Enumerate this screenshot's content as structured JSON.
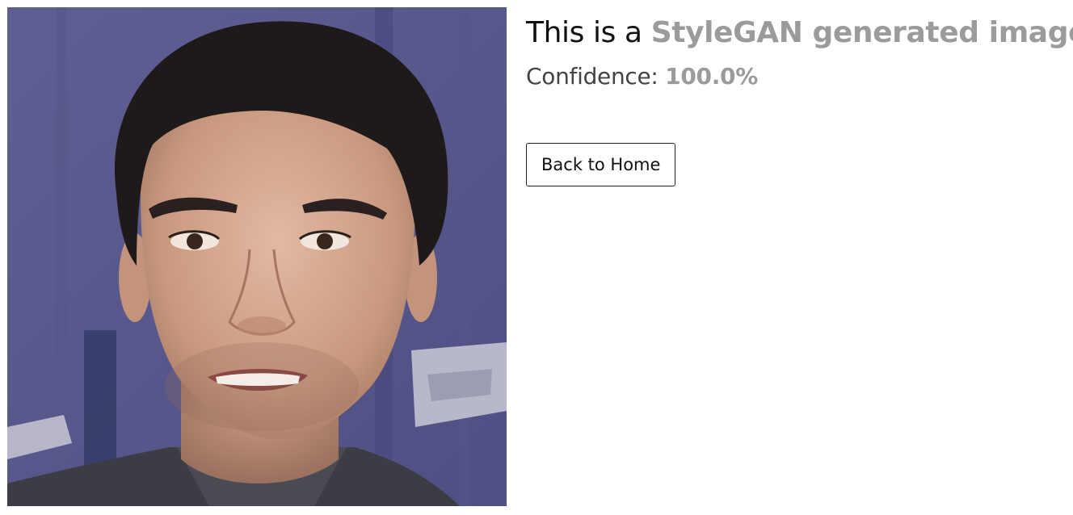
{
  "result": {
    "prefix": "This is a ",
    "classification": "StyleGAN generated image",
    "classification_color": "#9b9b9b"
  },
  "confidence": {
    "label": "Confidence: ",
    "value": "100.0%"
  },
  "actions": {
    "back_label": "Back to Home"
  }
}
